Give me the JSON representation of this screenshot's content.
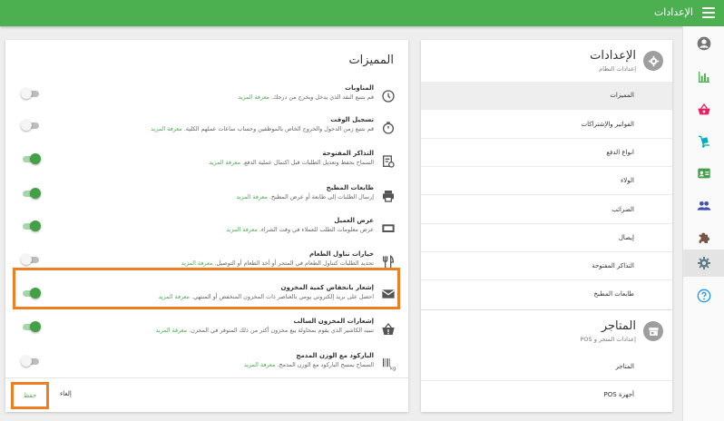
{
  "topbar": {
    "title": "الإعدادات",
    "menu_icon": "hamburger-menu-icon",
    "color": "#4caf50"
  },
  "rail": {
    "items": [
      {
        "name": "account",
        "icon": "account-circle-icon",
        "color": "#757575"
      },
      {
        "name": "reports",
        "icon": "bar-chart-icon",
        "color": "#4caf50"
      },
      {
        "name": "sales",
        "icon": "shopping-basket-icon",
        "color": "#e91e63"
      },
      {
        "name": "purchases",
        "icon": "dolly-icon",
        "color": "#00acc1"
      },
      {
        "name": "contacts",
        "icon": "contact-card-icon",
        "color": "#43a047"
      },
      {
        "name": "employees",
        "icon": "people-icon",
        "color": "#3f51b5"
      },
      {
        "name": "addons",
        "icon": "puzzle-icon",
        "color": "#795548"
      },
      {
        "name": "settings",
        "icon": "gear-icon",
        "color": "#607d8b",
        "active": true
      },
      {
        "name": "help",
        "icon": "help-circle-icon",
        "color": "#2196f3"
      }
    ]
  },
  "features": {
    "title": "المميزات",
    "items": [
      {
        "name": "المناوبات",
        "desc": "قم بتتبع النقد الذي يدخل ويخرج من درجك.",
        "link": "معرفة المزيد",
        "enabled": false,
        "icon": "clock-icon"
      },
      {
        "name": "تسجيل الوقت",
        "desc": "قم بتتبع زمن الدخول والخروج الخاص بالموظفين وحساب ساعات عملهم الكلية.",
        "link": "معرفة المزيد",
        "enabled": false,
        "icon": "stopwatch-icon"
      },
      {
        "name": "التذاكر المفتوحة",
        "desc": "السماح بحفظ وتعديل الطلبات قبل اكتمال عملية الدفع.",
        "link": "معرفة المزيد",
        "enabled": true,
        "icon": "ticket-clock-icon"
      },
      {
        "name": "طابعات المطبخ",
        "desc": "إرسال الطلبات إلى طابعة أو عرض المطبخ.",
        "link": "معرفة المزيد",
        "enabled": true,
        "icon": "printer-icon"
      },
      {
        "name": "عرض العميل",
        "desc": "عرض معلومات الطلب للعملاء في وقت الشراء.",
        "link": "معرفة المزيد",
        "enabled": true,
        "icon": "monitor-icon"
      },
      {
        "name": "خيارات تناول الطعام",
        "desc": "تحديد الطلبات كتناول الطعام في المتجر أو أخذ الطعام أو التوصيل.",
        "link": "معرفة المزيد",
        "enabled": false,
        "icon": "fork-knife-icon"
      },
      {
        "name": "إشعار بانخفاض كمية المخزون",
        "desc": "احصل على بريد إلكتروني يومي بالعناصر ذات المخزون المنخفض أو المنتهي.",
        "link": "معرفة المزيد",
        "enabled": true,
        "icon": "mail-icon"
      },
      {
        "name": "إشعارات المخزون السالب",
        "desc": "تنبيه الكاشير الذي يقوم بمحاولة بيع مخزون أكثر من ذلك المتوفر في المخزن.",
        "link": "معرفة المزيد",
        "enabled": true,
        "icon": "basket-alert-icon"
      },
      {
        "name": "الباركود مع الوزن المدمج",
        "desc": "السماح بمسح الباركود مع الوزن المدمج.",
        "link": "معرفة المزيد",
        "enabled": false,
        "icon": "barcode-weight-icon"
      }
    ],
    "save_label": "حفظ",
    "cancel_label": "إلغاء"
  },
  "settings_nav": {
    "section1": {
      "title": "الإعدادات",
      "subtitle": "إعدادات النظام",
      "icon": "gear-icon"
    },
    "items": [
      {
        "label": "المميزات",
        "active": true
      },
      {
        "label": "الفواتير والإشتراكات"
      },
      {
        "label": "انواع الدفع"
      },
      {
        "label": "الولاء"
      },
      {
        "label": "الضرائب"
      },
      {
        "label": "إيصال"
      },
      {
        "label": "التذاكر المفتوحة"
      },
      {
        "label": "طابعات المطبخ"
      }
    ],
    "section2": {
      "title": "المتاجر",
      "subtitle": "إعدادات المتجر و POS",
      "icon": "store-icon"
    },
    "items2": [
      {
        "label": "المتاجر"
      },
      {
        "label": "أجهزة POS"
      }
    ]
  }
}
